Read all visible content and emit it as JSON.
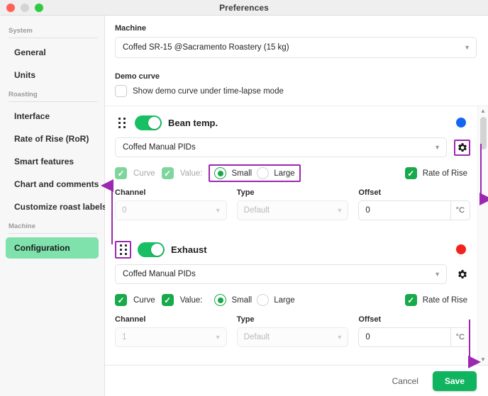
{
  "window": {
    "title": "Preferences",
    "controls": [
      "close",
      "minimize",
      "maximize"
    ]
  },
  "sidebar": {
    "groups": [
      {
        "label": "System",
        "items": [
          {
            "label": "General",
            "active": false
          },
          {
            "label": "Units",
            "active": false
          }
        ]
      },
      {
        "label": "Roasting",
        "items": [
          {
            "label": "Interface",
            "active": false
          },
          {
            "label": "Rate of Rise (RoR)",
            "active": false
          },
          {
            "label": "Smart features",
            "active": false
          },
          {
            "label": "Chart and comments",
            "active": false
          },
          {
            "label": "Customize roast labels",
            "active": false
          }
        ]
      },
      {
        "label": "Machine",
        "items": [
          {
            "label": "Configuration",
            "active": true
          }
        ]
      }
    ]
  },
  "main": {
    "machine": {
      "label": "Machine",
      "value": "Coffed SR-15 @Sacramento Roastery (15 kg)",
      "caret": "chevron-down"
    },
    "demo_curve": {
      "label": "Demo curve",
      "checkbox_label": "Show demo curve under time-lapse mode",
      "checked": false
    },
    "cards": [
      {
        "title": "Bean temp.",
        "enabled": true,
        "color": "#1565f0",
        "pid": {
          "value": "Coffed Manual PIDs"
        },
        "gear_label": "settings",
        "curve": {
          "label": "Curve",
          "checked": true,
          "dimmed": true
        },
        "value": {
          "label": "Value:",
          "checked": true,
          "dimmed": true
        },
        "size": {
          "options": [
            "Small",
            "Large"
          ],
          "selected": "Small"
        },
        "rate_of_rise": {
          "label": "Rate of Rise",
          "checked": true,
          "dimmed": false
        },
        "channel": {
          "label": "Channel",
          "value": "0",
          "disabled": true
        },
        "type": {
          "label": "Type",
          "value": "Default",
          "disabled": true
        },
        "offset": {
          "label": "Offset",
          "value": "0",
          "unit": "°C"
        }
      },
      {
        "title": "Exhaust",
        "enabled": true,
        "color": "#f2221f",
        "pid": {
          "value": "Coffed Manual PIDs"
        },
        "gear_label": "settings",
        "curve": {
          "label": "Curve",
          "checked": true,
          "dimmed": false
        },
        "value": {
          "label": "Value:",
          "checked": true,
          "dimmed": false
        },
        "size": {
          "options": [
            "Small",
            "Large"
          ],
          "selected": "Small"
        },
        "rate_of_rise": {
          "label": "Rate of Rise",
          "checked": true,
          "dimmed": false
        },
        "channel": {
          "label": "Channel",
          "value": "1",
          "disabled": true
        },
        "type": {
          "label": "Type",
          "value": "Default",
          "disabled": true
        },
        "offset": {
          "label": "Offset",
          "value": "0",
          "unit": "°C"
        }
      }
    ]
  },
  "scrollbar": {
    "up_arrow": "▲",
    "down_arrow": "▼"
  },
  "footer": {
    "cancel_label": "Cancel",
    "save_label": "Save"
  },
  "annotations": {
    "color": "#9c28b0",
    "highlight_boxes": [
      "size-radio-group-bean",
      "gear-button-bean",
      "drag-handle-exhaust"
    ],
    "arrows": [
      "up-to-drag-handle",
      "down-to-scroll",
      "down-to-save"
    ]
  }
}
